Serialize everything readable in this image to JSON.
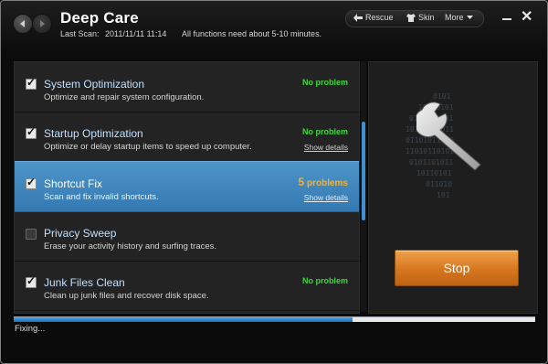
{
  "window": {
    "title": "Deep Care",
    "last_scan_label": "Last Scan:",
    "last_scan_value": "2011/11/11 11:14",
    "scan_note": "All functions need about 5-10 minutes."
  },
  "toolbar": {
    "rescue_label": "Rescue",
    "skin_label": "Skin",
    "more_label": "More"
  },
  "items": [
    {
      "name": "System Optimization",
      "description": "Optimize and repair system configuration.",
      "status": "No problem",
      "checked": true,
      "show_details": ""
    },
    {
      "name": "Startup Optimization",
      "description": "Optimize or delay startup items to speed up computer.",
      "status": "No problem",
      "checked": true,
      "show_details": "Show details"
    },
    {
      "name": "Shortcut Fix",
      "description": "Scan and fix invalid shortcuts.",
      "status_count": "5",
      "status_suffix": "problems",
      "checked": true,
      "show_details": "Show details"
    },
    {
      "name": "Privacy Sweep",
      "description": "Erase your activity history and surfing traces.",
      "status": "",
      "checked": false,
      "show_details": ""
    },
    {
      "name": "Junk Files Clean",
      "description": "Clean up junk files and recover disk space.",
      "status": "No problem",
      "checked": true,
      "show_details": ""
    }
  ],
  "actions": {
    "stop_label": "Stop"
  },
  "progress": {
    "fraction": 0.65,
    "status_text": "Fixing..."
  },
  "colors": {
    "accent_blue": "#3f8fd2",
    "ok_green": "#3dd63d",
    "problem_orange": "#f5b233",
    "stop_orange": "#d6761e"
  }
}
